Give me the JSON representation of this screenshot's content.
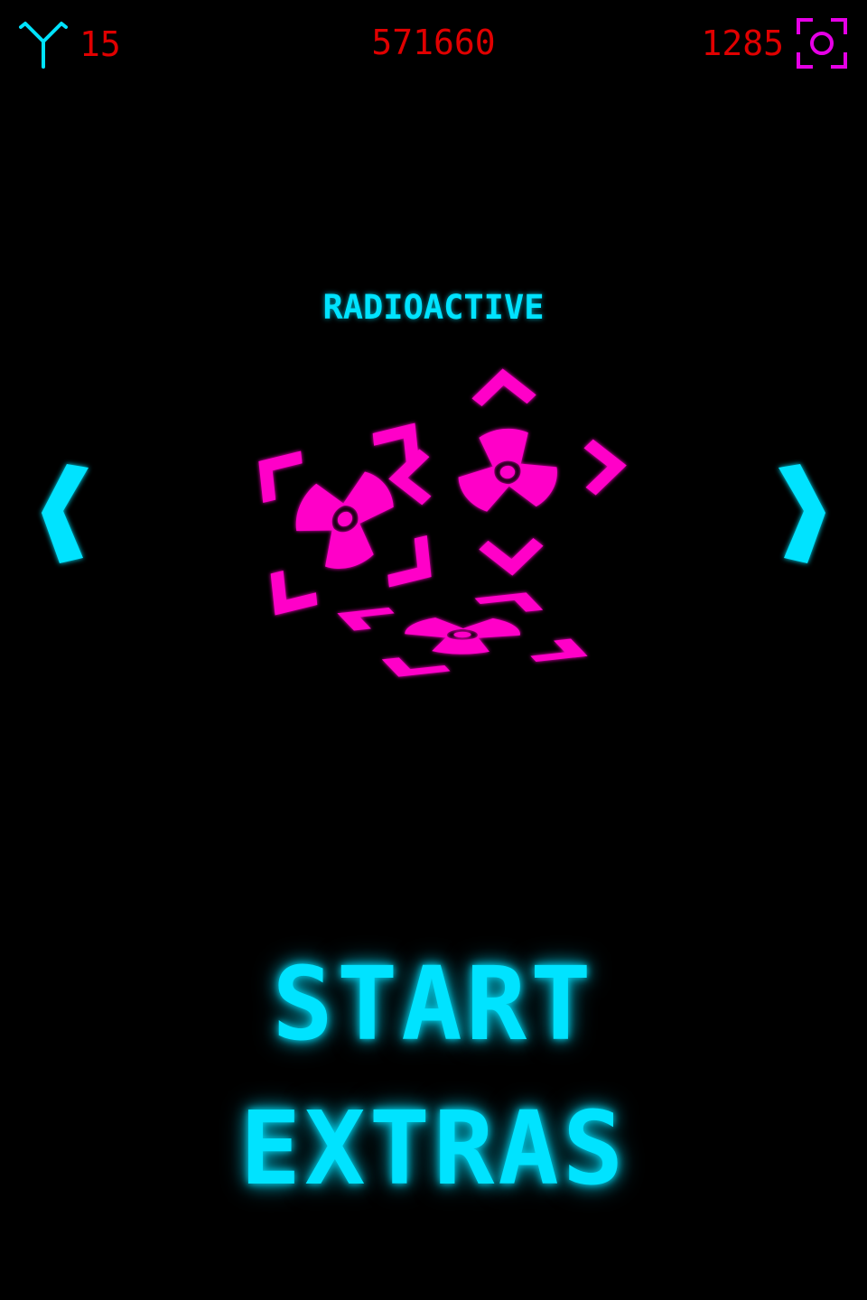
{
  "hud": {
    "lives_icon": "y-shape-icon",
    "lives": "15",
    "score": "571660",
    "currency": "1285",
    "currency_icon": "target-reticle-icon"
  },
  "skin_selector": {
    "name": "RADIOACTIVE",
    "prev_icon": "chevron-left-icon",
    "next_icon": "chevron-right-icon",
    "preview_icon": "radioactive-cube-icon"
  },
  "menu": {
    "start": "START",
    "extras": "EXTRAS"
  },
  "colors": {
    "background": "#000000",
    "accent_cyan": "#00e3ff",
    "hud_red": "#e00000",
    "magenta": "#ff00c8",
    "reticle_magenta": "#e600e6"
  }
}
